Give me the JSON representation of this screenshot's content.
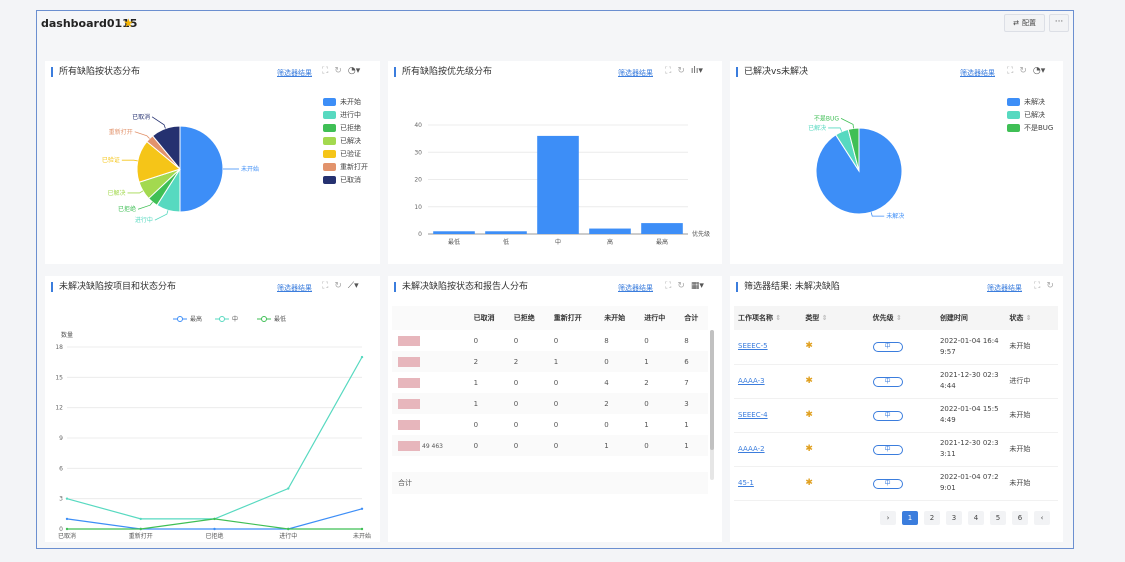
{
  "dashboard": {
    "title": "dashboard0115",
    "config_label": "配置",
    "more_label": "···"
  },
  "colors": {
    "blue": "#3d8ef7",
    "teal": "#57d9c0",
    "green": "#3fbf55",
    "lime": "#a3d94f",
    "yellow": "#f5c518",
    "orange": "#e2936c",
    "navy": "#253170"
  },
  "filter_link_label": "筛选器结果",
  "cards": {
    "status_pie": {
      "title": "所有缺陷按状态分布",
      "chart_data": {
        "type": "pie",
        "title": "所有缺陷按状态分布",
        "slices": [
          {
            "label": "未开始",
            "value": 50,
            "color": "#3d8ef7"
          },
          {
            "label": "进行中",
            "value": 9,
            "color": "#57d9c0"
          },
          {
            "label": "已拒绝",
            "value": 4,
            "color": "#3fbf55"
          },
          {
            "label": "已解决",
            "value": 7,
            "color": "#a3d94f"
          },
          {
            "label": "已验证",
            "value": 16,
            "color": "#f5c518"
          },
          {
            "label": "重新打开",
            "value": 3,
            "color": "#e2936c"
          },
          {
            "label": "已取消",
            "value": 11,
            "color": "#253170"
          }
        ],
        "legend_position": "right"
      }
    },
    "priority_bar": {
      "title": "所有缺陷按优先级分布",
      "chart_data": {
        "type": "bar",
        "title": "所有缺陷按优先级分布",
        "categories": [
          "最低",
          "低",
          "中",
          "高",
          "最高"
        ],
        "values": [
          1,
          1,
          36,
          2,
          4
        ],
        "xlabel": "优先级",
        "ylabel": "",
        "ylim": [
          0,
          40
        ],
        "yticks": [
          0,
          10,
          20,
          30,
          40
        ],
        "color": "#3d8ef7",
        "grid": true
      }
    },
    "resolved_pie": {
      "title": "已解决vs未解决",
      "chart_data": {
        "type": "pie",
        "title": "已解决vs未解决",
        "slices": [
          {
            "label": "未解决",
            "value": 90,
            "color": "#3d8ef7"
          },
          {
            "label": "已解决",
            "value": 5,
            "color": "#57d9c0"
          },
          {
            "label": "不是BUG",
            "value": 4,
            "color": "#3fbf55"
          }
        ],
        "legend_position": "top-right"
      }
    },
    "project_line": {
      "title": "未解决缺陷按项目和状态分布",
      "chart_data": {
        "type": "line",
        "title": "未解决缺陷按项目和状态分布",
        "categories": [
          "已取消",
          "重新打开",
          "已拒绝",
          "进行中",
          "未开始"
        ],
        "ylabel": "数量",
        "ylim": [
          0,
          18
        ],
        "yticks": [
          0,
          3,
          6,
          9,
          12,
          15,
          18
        ],
        "grid": true,
        "legend_position": "top",
        "series": [
          {
            "name": "最高",
            "values": [
              1,
              0,
              0,
              0,
              2
            ],
            "color": "#3d8ef7"
          },
          {
            "name": "中",
            "values": [
              3,
              1,
              1,
              4,
              17
            ],
            "color": "#57d9c0"
          },
          {
            "name": "最低",
            "values": [
              0,
              0,
              1,
              0,
              0
            ],
            "color": "#3fbf55"
          }
        ]
      }
    },
    "matrix": {
      "title": "未解决缺陷按状态和报告人分布",
      "headers": [
        "",
        "已取消",
        "已拒绝",
        "重新打开",
        "未开始",
        "进行中",
        "合计"
      ],
      "rows": [
        {
          "name": "",
          "cells": [
            "0",
            "0",
            "0",
            "8",
            "0",
            "8"
          ]
        },
        {
          "name": "",
          "cells": [
            "2",
            "2",
            "1",
            "0",
            "1",
            "6"
          ]
        },
        {
          "name": "",
          "cells": [
            "1",
            "0",
            "0",
            "4",
            "2",
            "7"
          ]
        },
        {
          "name": "",
          "cells": [
            "1",
            "0",
            "0",
            "2",
            "0",
            "3"
          ]
        },
        {
          "name": "",
          "cells": [
            "0",
            "0",
            "0",
            "0",
            "1",
            "1"
          ]
        },
        {
          "name": "49 463",
          "cells": [
            "0",
            "0",
            "0",
            "1",
            "0",
            "1"
          ]
        }
      ],
      "footer": "合计"
    },
    "issues": {
      "title": "筛选器结果: 未解决缺陷",
      "headers": [
        "工作项名称",
        "类型",
        "优先级",
        "创建时间",
        "状态"
      ],
      "rows": [
        {
          "name": "SEEEC-5",
          "priority": "中",
          "created": "2022-01-04 16:4 9:57",
          "status": "未开始"
        },
        {
          "name": "AAAA-3",
          "priority": "中",
          "created": "2021-12-30 02:3 4:44",
          "status": "进行中"
        },
        {
          "name": "SEEEC-4",
          "priority": "中",
          "created": "2022-01-04 15:5 4:49",
          "status": "未开始"
        },
        {
          "name": "AAAA-2",
          "priority": "中",
          "created": "2021-12-30 02:3 3:11",
          "status": "未开始"
        },
        {
          "name": "45-1",
          "priority": "中",
          "created": "2022-01-04 07:2 9:01",
          "status": "未开始"
        }
      ],
      "pagination": {
        "prev": "›",
        "pages": [
          "1",
          "2",
          "3",
          "4",
          "5",
          "6"
        ],
        "current": "1",
        "next": "‹"
      }
    }
  }
}
